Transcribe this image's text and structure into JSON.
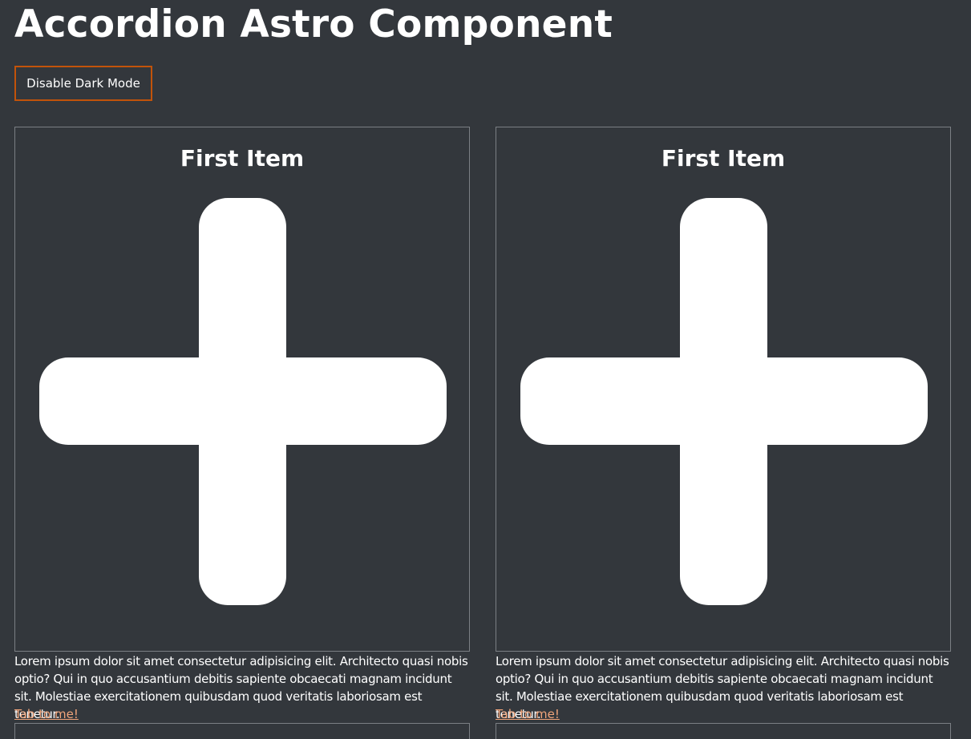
{
  "page": {
    "title": "Accordion Astro Component"
  },
  "controls": {
    "dark_mode_button_label": "Disable Dark Mode"
  },
  "accordions": [
    {
      "item_title": "First Item",
      "icon": "plus-icon",
      "panel_text": "Lorem ipsum dolor sit amet consectetur adipisicing elit. Architecto quasi nobis optio? Qui in quo accusantium debitis sapiente obcaecati magnam incidunt sit. Molestiae exercitationem quibusdam quod veritatis laboriosam est tenetur.",
      "link_text": "Tab to me!"
    },
    {
      "item_title": "First Item",
      "icon": "plus-icon",
      "panel_text": "Lorem ipsum dolor sit amet consectetur adipisicing elit. Architecto quasi nobis optio? Qui in quo accusantium debitis sapiente obcaecati magnam incidunt sit. Molestiae exercitationem quibusdam quod veritatis laboriosam est tenetur.",
      "link_text": "Tab to me!"
    }
  ],
  "colors": {
    "background": "#33373c",
    "text": "#ffffff",
    "button_border": "#c2530a",
    "link": "#f0a47a",
    "border": "#7b7f84"
  }
}
